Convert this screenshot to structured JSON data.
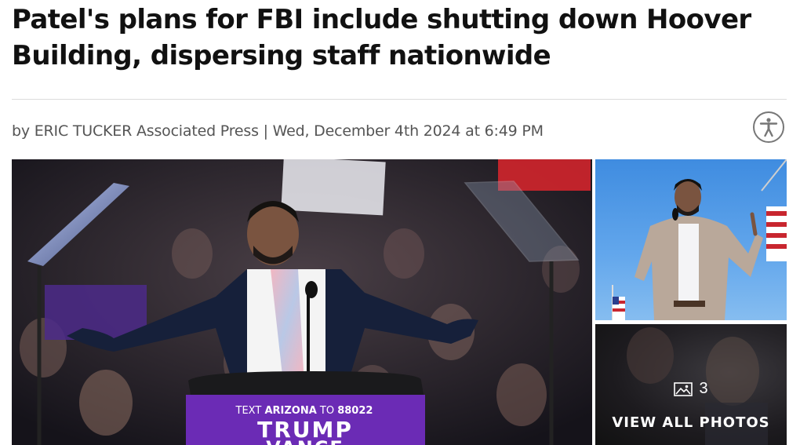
{
  "article": {
    "headline": "Patel's plans for FBI include shutting down Hoover Building, dispersing staff nationwide",
    "byline": "by ERIC TUCKER Associated Press | Wed, December 4th 2024 at 6:49 PM"
  },
  "gallery": {
    "photo_count": "3",
    "view_all_label": "VIEW ALL PHOTOS",
    "podium_sign": {
      "line1_text": "TEXT ",
      "line1_bold": "ARIZONA",
      "line1_mid": " TO ",
      "line1_num": "88022",
      "line2": "TRUMP",
      "line3": "VANCE"
    }
  },
  "icons": {
    "accessibility": "accessibility-icon",
    "photo_count": "image-icon"
  },
  "colors": {
    "headline": "#111111",
    "byline": "#555555",
    "podium_sign": "#6b2bb5",
    "accent_red": "#e0242f"
  }
}
